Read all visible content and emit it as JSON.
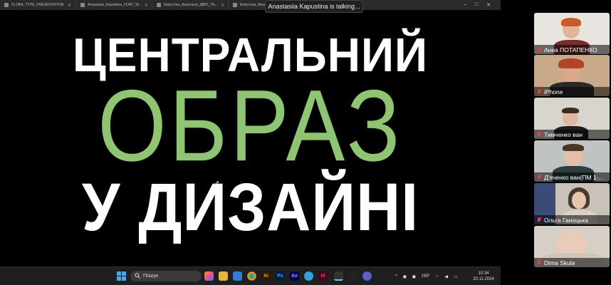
{
  "browser": {
    "tabs": [
      {
        "label": "FLORA_TYPE_PRESENTATION"
      },
      {
        "label": "Anastasiia_Kapustina_FONT_W..."
      },
      {
        "label": "Капустіна_Анастасія_ДВК1_По..."
      },
      {
        "label": "Капустіна_Анаст..."
      }
    ],
    "new_tab": "+",
    "controls": {
      "minimize": "–",
      "maximize": "□",
      "close": "✕"
    }
  },
  "talking_indicator": "Anastasiia Kapustina is talking...",
  "slide": {
    "line1": "ЦЕНТРАЛЬНИЙ",
    "line2": "ОБРАЗ",
    "line3": "У ДИЗАЙНІ",
    "colors": {
      "white": "#ffffff",
      "green": "#8fc472",
      "background": "#000000"
    }
  },
  "taskbar": {
    "search_placeholder": "Пошук",
    "language": "УКР",
    "time": "10:34",
    "date": "20.11.2024",
    "tray_chevron": "^",
    "icons": [
      "windows-icon",
      "copilot-icon",
      "files-icon",
      "store-icon",
      "chrome-icon",
      "illustrator-icon",
      "photoshop-icon",
      "after-effects-icon",
      "telegram-icon",
      "indesign-icon",
      "figma-icon",
      "figma2-icon",
      "more-icon"
    ]
  },
  "participants": [
    {
      "name": "Анна ПОТАПЕНКО",
      "muted": true,
      "bg": "#e8e4e0"
    },
    {
      "name": "iPhone",
      "muted": true,
      "bg": "#c8a98a"
    },
    {
      "name": "Тимченко  ван",
      "muted": true,
      "bg": "#d8d5cf"
    },
    {
      "name": "Д'яченко  ван(ПМ 1-...",
      "muted": true,
      "bg": "#bfc4c3"
    },
    {
      "name": "Ольга Ганоцька",
      "muted": true,
      "bg": "#c9c2b8"
    },
    {
      "name": "Dima Skula",
      "muted": true,
      "bg": "#d6cfc6"
    }
  ]
}
